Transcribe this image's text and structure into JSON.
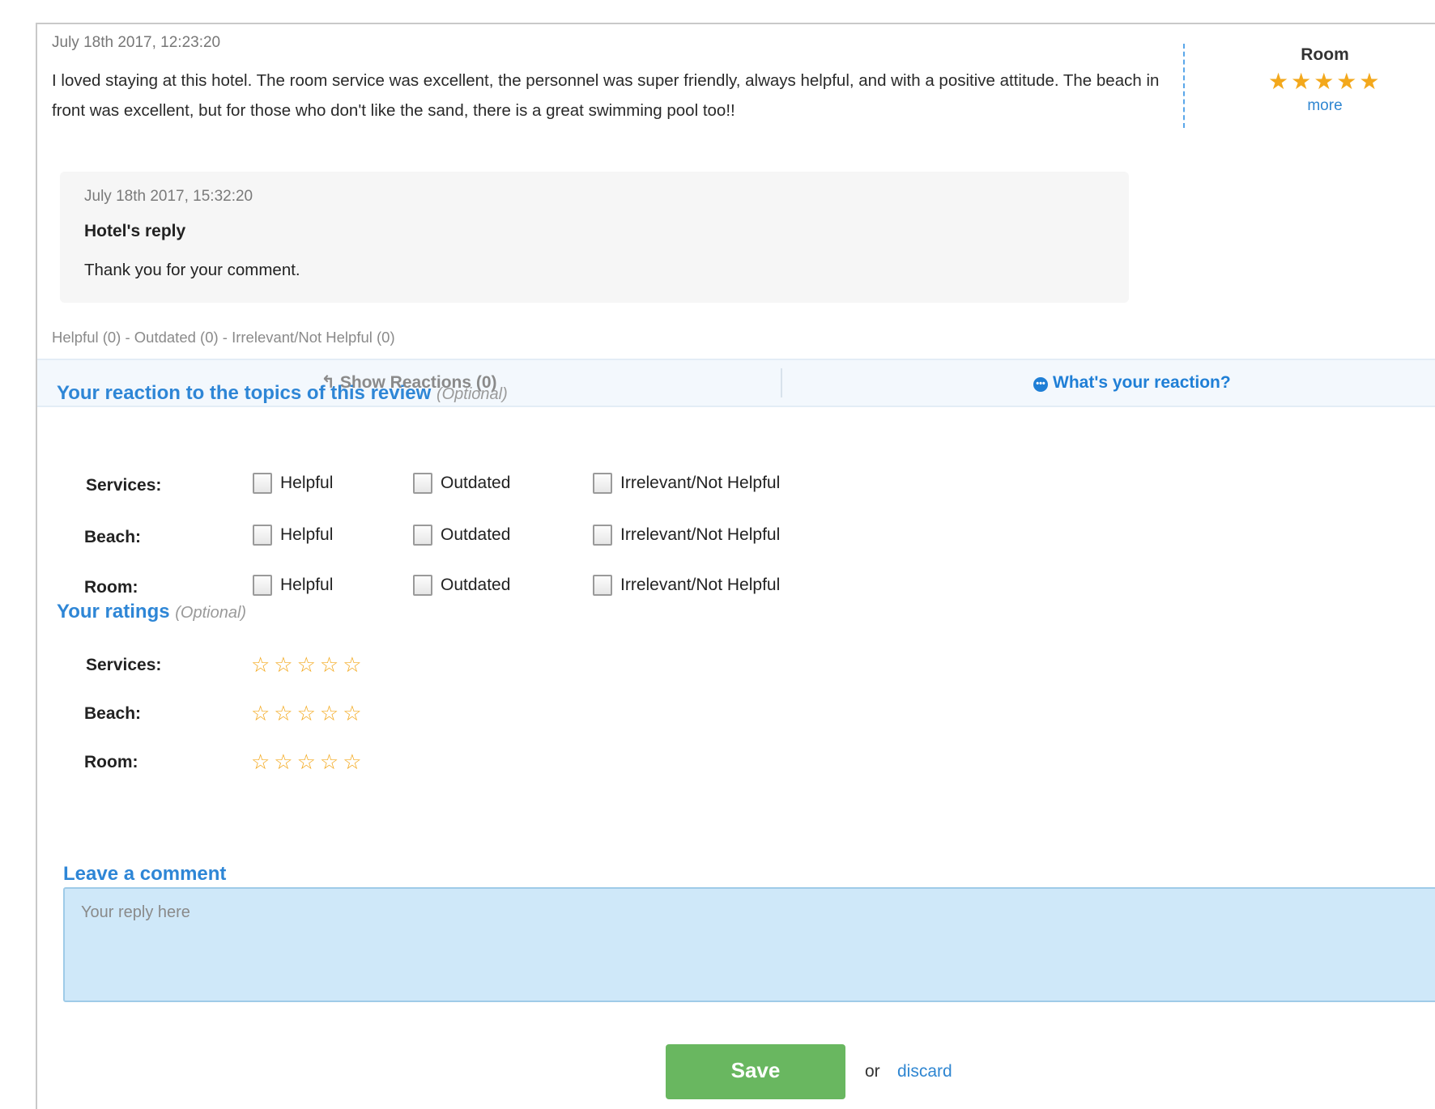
{
  "review": {
    "date": "July 18th 2017, 12:23:20",
    "text": "I loved staying at this hotel. The room service was excellent, the personnel was super friendly, always helpful, and with a positive attitude. The beach in front was excellent, but for those who don't like the sand, there is a great swimming pool too!!",
    "rating": {
      "title": "Room",
      "stars": "★★★★★",
      "value": 5,
      "max": 5,
      "more_label": "more"
    }
  },
  "reply": {
    "date": "July 18th 2017, 15:32:20",
    "author": "Hotel's reply",
    "text": "Thank you for your comment."
  },
  "votes_summary": "Helpful (0) - Outdated (0) - Irrelevant/Not Helpful (0)",
  "reaction_bar": {
    "show_reactions": "↰ Show Reactions (0)",
    "whats_your_reaction": "What's your reaction?"
  },
  "reactions_section": {
    "title": "Your reaction to the topics of this review",
    "optional": "(Optional)",
    "options": [
      "Helpful",
      "Outdated",
      "Irrelevant/Not Helpful"
    ],
    "topics": [
      {
        "label": "Services:",
        "checked": [
          false,
          false,
          false
        ]
      },
      {
        "label": "Beach:",
        "checked": [
          false,
          false,
          false
        ]
      },
      {
        "label": "Room:",
        "checked": [
          false,
          false,
          false
        ]
      }
    ]
  },
  "ratings_section": {
    "title": "Your ratings",
    "optional": "(Optional)",
    "rows": [
      {
        "label": "Services:",
        "stars": "☆☆☆☆☆",
        "value": 0,
        "max": 5
      },
      {
        "label": "Beach:",
        "stars": "☆☆☆☆☆",
        "value": 0,
        "max": 5
      },
      {
        "label": "Room:",
        "stars": "☆☆☆☆☆",
        "value": 0,
        "max": 5
      }
    ]
  },
  "comment_section": {
    "title": "Leave a comment",
    "placeholder": "Your reply here",
    "value": ""
  },
  "actions": {
    "save_label": "Save",
    "or_text": "or",
    "discard_label": "discard"
  },
  "colors": {
    "accent": "#2e86d6",
    "star": "#f3a81c",
    "save": "#69b760",
    "comment_bg": "#cfe8f9"
  }
}
